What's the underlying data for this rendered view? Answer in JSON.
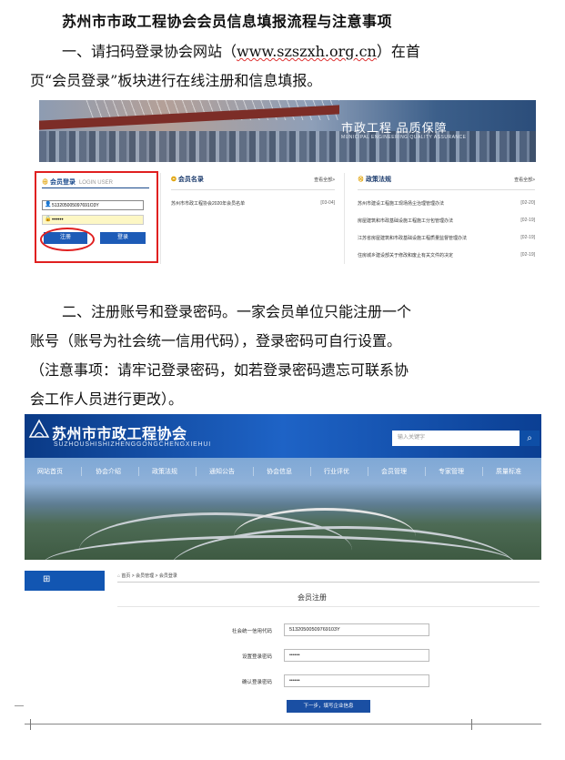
{
  "title": "苏州市市政工程协会会员信息填报流程与注意事项",
  "para1": {
    "line1_prefix": "一、请扫码登录协会网站（",
    "url": "www.szszxh.org.cn",
    "line1_suffix": "）在首",
    "line2": "页“会员登录”板块进行在线注册和信息填报。"
  },
  "para2": {
    "line1": "二、注册账号和登录密码。一家会员单位只能注册一个",
    "line2": "账号（账号为社会统一信用代码），登录密码可自行设置。",
    "line3": "（注意事项：请牢记登录密码，如若登录密码遗忘可联系协",
    "line4": "会工作人员进行更改）。"
  },
  "shot1": {
    "banner_title": "市政工程  品质保障",
    "banner_sub": "MUNICIPAL ENGINEERING QUALITY ASSURANCE",
    "login": {
      "heading": "会员登录",
      "heading_en": "LOGIN USER",
      "username": "513205005097691O3Y",
      "password": "••••••",
      "register_label": "注册",
      "login_label": "登录"
    },
    "members": {
      "heading": "会员名录",
      "more": "查看全部>",
      "items": [
        {
          "text": "苏州市市政工程协会2020年会员名单",
          "date": "[03-04]"
        }
      ]
    },
    "policy": {
      "heading": "政策法规",
      "more": "查看全部>",
      "items": [
        {
          "text": "苏州市建设工程施工现场扬尘治理管理办法",
          "date": "[02-20]"
        },
        {
          "text": "房屋建筑和市政基础设施工程施工分包管理办法",
          "date": "[02-19]"
        },
        {
          "text": "江苏省房屋建筑和市政基础设施工程质量监督管理办法",
          "date": "[02-19]"
        },
        {
          "text": "住房城乡建设部关于修改和废止有关文件的决定",
          "date": "[02-19]"
        }
      ]
    }
  },
  "shot2": {
    "site_name": "苏州市市政工程协会",
    "site_pinyin": "SUZHOUSHISHIZHENGGONGCHENGXIEHUI",
    "search_placeholder": "输入关键字",
    "nav": [
      "网站首页",
      "协会介绍",
      "政策法规",
      "通知公告",
      "协会信息",
      "行业评优",
      "会员管理",
      "专家管理",
      "质量标准"
    ],
    "breadcrumb": "首页 > 会员管理 > 会员登录",
    "reg_title": "会员注册",
    "fields": [
      {
        "label": "社会统一信用代码",
        "value": "51320500509769103Y"
      },
      {
        "label": "设置登录密码",
        "value": "••••••"
      },
      {
        "label": "确认登录密码",
        "value": "••••••"
      }
    ],
    "next_button": "下一步，填写企业信息"
  }
}
